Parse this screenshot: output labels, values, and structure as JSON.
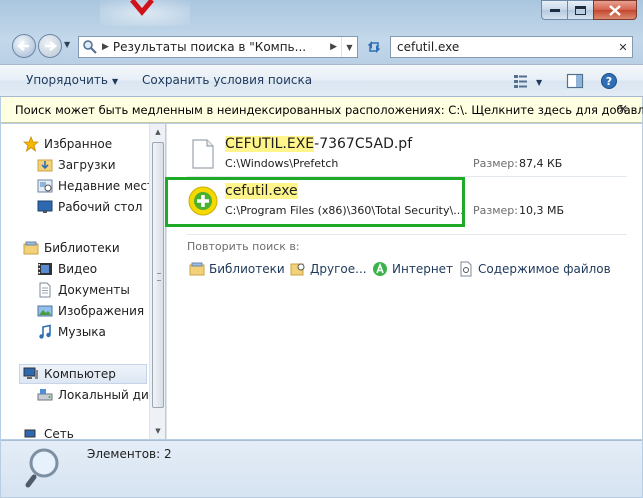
{
  "window": {
    "controls": {
      "minimize": "minimize",
      "maximize": "maximize",
      "close": "close"
    }
  },
  "address": {
    "path": "Результаты поиска в \"Компь..."
  },
  "search": {
    "value": "cefutil.exe"
  },
  "toolbar": {
    "organize": "Упорядочить",
    "save_search": "Сохранить условия поиска"
  },
  "infobar": {
    "text": "Поиск может быть медленным в неиндексированных расположениях: C:\\. Щелкните здесь для добавле..."
  },
  "sidebar": {
    "favorites": "Избранное",
    "favorites_items": [
      "Загрузки",
      "Недавние места",
      "Рабочий стол"
    ],
    "libraries": "Библиотеки",
    "libraries_items": [
      "Видео",
      "Документы",
      "Изображения",
      "Музыка"
    ],
    "computer": "Компьютер",
    "computer_items": [
      "Локальный диск"
    ],
    "network_partial": "Сеть"
  },
  "results": [
    {
      "name_match": "CEFUTIL.EXE",
      "name_rest": "-7367C5AD.pf",
      "path": "C:\\Windows\\Prefetch",
      "size_label": "Размер:",
      "size": "87,4 КБ",
      "icon": "document-icon"
    },
    {
      "name_match": "cefutil.exe",
      "name_rest": "",
      "path": "C:\\Program Files (x86)\\360\\Total Security\\...",
      "size_label": "Размер:",
      "size": "10,3 МБ",
      "icon": "360-total-security-icon"
    }
  ],
  "search_again": {
    "label": "Повторить поиск в:",
    "items": [
      "Библиотеки",
      "Другое...",
      "Интернет",
      "Содержимое файлов"
    ]
  },
  "details": {
    "count": "Элементов: 2"
  },
  "colors": {
    "highlight": "#fff58b",
    "annotation_box": "#1eaa26",
    "infobar_bg": "#ffffe1"
  }
}
